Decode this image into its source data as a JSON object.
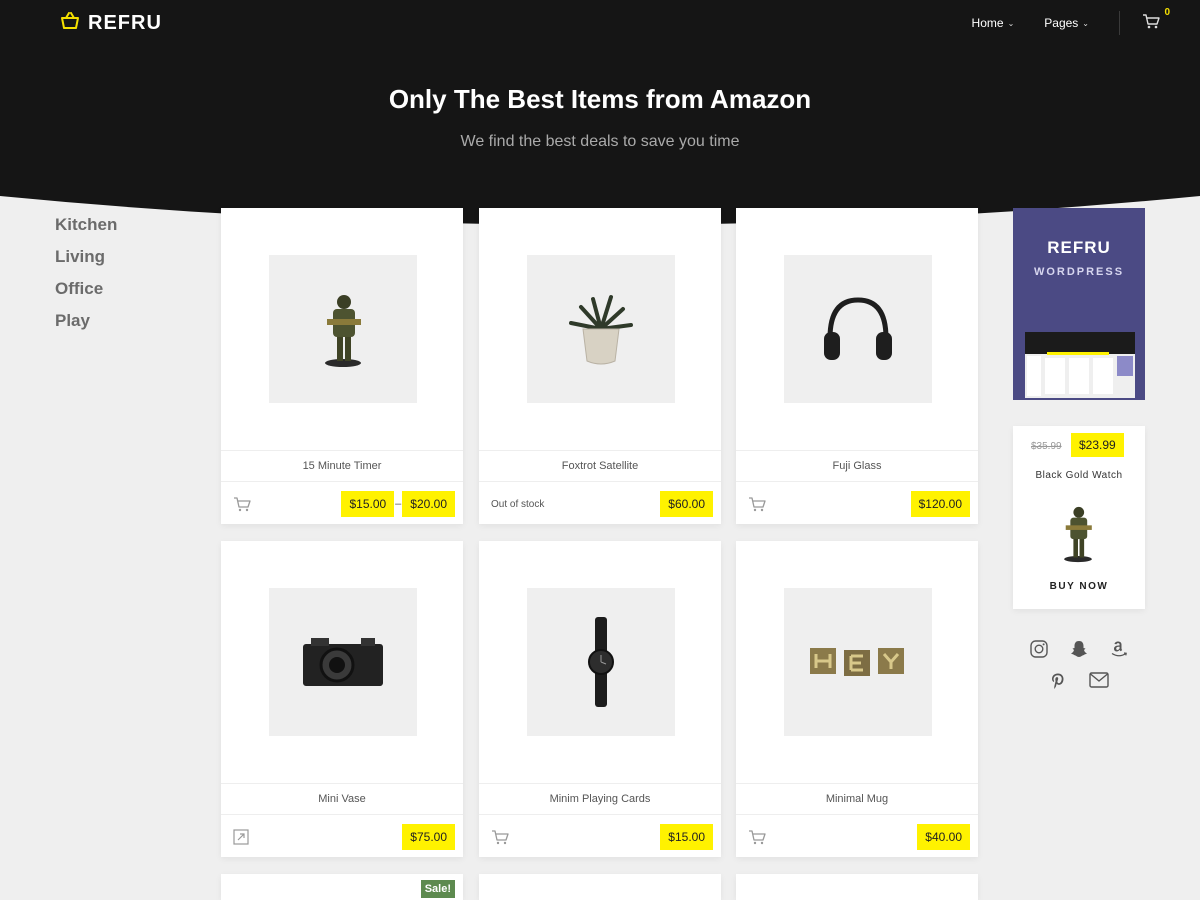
{
  "brand": {
    "name": "REFRU"
  },
  "nav": {
    "items": [
      {
        "label": "Home"
      },
      {
        "label": "Pages"
      }
    ],
    "cart_count": "0"
  },
  "hero": {
    "title": "Only The Best Items from Amazon",
    "subtitle": "We find the best deals to save you time"
  },
  "categories": [
    "Kitchen",
    "Living",
    "Office",
    "Play"
  ],
  "products": [
    {
      "name": "15 Minute Timer",
      "price_from": "$15.00",
      "price_to": "$20.00",
      "action_icon": "cart-icon"
    },
    {
      "name": "Foxtrot Satellite",
      "status": "Out of stock",
      "price": "$60.00"
    },
    {
      "name": "Fuji Glass",
      "price": "$120.00",
      "action_icon": "cart-icon"
    },
    {
      "name": "Mini Vase",
      "price": "$75.00",
      "action_icon": "external-link-icon"
    },
    {
      "name": "Minim Playing Cards",
      "price": "$15.00",
      "action_icon": "cart-icon"
    },
    {
      "name": "Minimal Mug",
      "price": "$40.00",
      "action_icon": "cart-icon"
    }
  ],
  "partial_row": {
    "sale_badge": "Sale!"
  },
  "promo": {
    "title": "REFRU",
    "subtitle": "WORDPRESS"
  },
  "deal": {
    "old_price": "$35.99",
    "new_price": "$23.99",
    "name": "Black Gold Watch",
    "button": "BUY NOW"
  },
  "social_icons": [
    "instagram-icon",
    "snapchat-icon",
    "amazon-icon",
    "pinterest-icon",
    "mail-icon"
  ],
  "colors": {
    "header": "#151515",
    "accent": "#fff200",
    "sale": "#5d8a4f",
    "promo": "#4b4a84",
    "page": "#efefef"
  }
}
